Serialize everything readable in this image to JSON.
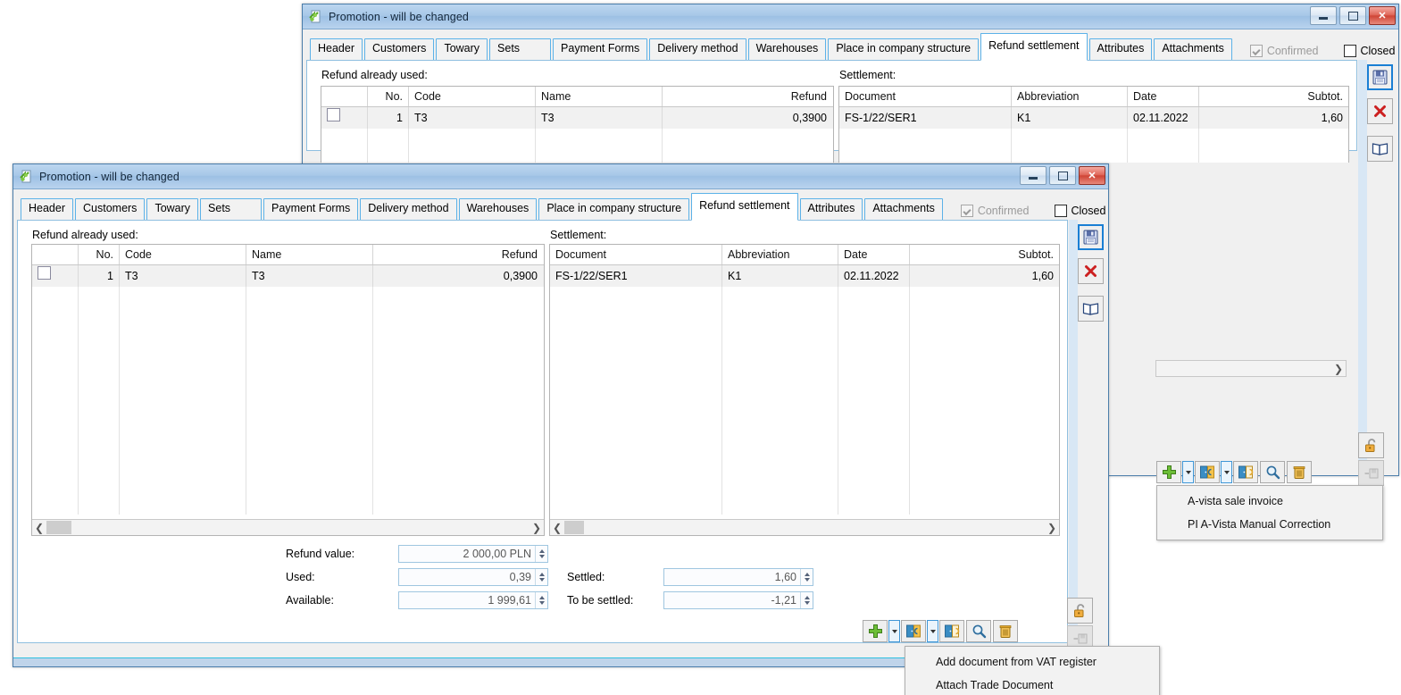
{
  "window1": {
    "title": "Promotion - will be changed",
    "app_icon": "promotion-icon",
    "controls": {
      "minimize": "minimize",
      "maximize": "maximize",
      "close": "close"
    },
    "tabs": [
      {
        "label": "Header",
        "active": false
      },
      {
        "label": "Customers",
        "active": false
      },
      {
        "label": "Towary",
        "active": false
      },
      {
        "label": "Sets",
        "active": false
      },
      {
        "label": "Payment Forms",
        "active": false
      },
      {
        "label": "Delivery method",
        "active": false
      },
      {
        "label": "Warehouses",
        "active": false
      },
      {
        "label": "Place in company structure",
        "active": false
      },
      {
        "label": "Refund settlement",
        "active": true
      },
      {
        "label": "Attributes",
        "active": false
      },
      {
        "label": "Attachments",
        "active": false
      }
    ],
    "confirmed": {
      "label": "Confirmed",
      "checked": true,
      "disabled": true
    },
    "closed": {
      "label": "Closed",
      "checked": false,
      "disabled": false
    },
    "refund_used": {
      "caption": "Refund already used:",
      "columns": [
        "",
        "No.",
        "Code",
        "Name",
        "Refund"
      ],
      "rows": [
        {
          "check": false,
          "no": "1",
          "code": "T3",
          "name": "T3",
          "refund": "0,3900"
        }
      ]
    },
    "settlement": {
      "caption": "Settlement:",
      "columns": [
        "Document",
        "Abbreviation",
        "Date",
        "Subtot."
      ],
      "rows": [
        {
          "document": "FS-1/22/SER1",
          "abbreviation": "K1",
          "date": "02.11.2022",
          "subtotal": "1,60"
        }
      ]
    },
    "side_toolbar": [
      {
        "name": "save-button",
        "icon": "floppy-disk-icon",
        "accent": true
      },
      {
        "name": "cancel-button",
        "icon": "red-x-icon",
        "accent": false
      },
      {
        "name": "book-button",
        "icon": "open-book-icon",
        "accent": false
      }
    ],
    "lock_buttons": [
      {
        "name": "unlock-button",
        "icon": "open-padlock-icon",
        "disabled": false
      },
      {
        "name": "pin-save-button",
        "icon": "pin-save-icon",
        "disabled": true
      }
    ],
    "bottom_toolbar": [
      {
        "name": "add-button",
        "icon": "green-plus-icon"
      },
      {
        "name": "add-dropdown-arrow",
        "icon": "caret-down-icon"
      },
      {
        "name": "attach-document-button",
        "icon": "door-in-icon"
      },
      {
        "name": "attach-dropdown-arrow",
        "icon": "caret-down-icon"
      },
      {
        "name": "detach-document-button",
        "icon": "door-out-icon"
      },
      {
        "name": "preview-button",
        "icon": "magnifier-icon"
      },
      {
        "name": "delete-button",
        "icon": "trash-icon"
      }
    ],
    "context_menu": {
      "items": [
        "A-vista sale invoice",
        "PI A-Vista Manual Correction"
      ]
    }
  },
  "window2": {
    "title": "Promotion - will be changed",
    "app_icon": "promotion-icon",
    "controls": {
      "minimize": "minimize",
      "maximize": "maximize",
      "close": "close"
    },
    "tabs": [
      {
        "label": "Header",
        "active": false
      },
      {
        "label": "Customers",
        "active": false
      },
      {
        "label": "Towary",
        "active": false
      },
      {
        "label": "Sets",
        "active": false
      },
      {
        "label": "Payment Forms",
        "active": false
      },
      {
        "label": "Delivery method",
        "active": false
      },
      {
        "label": "Warehouses",
        "active": false
      },
      {
        "label": "Place in company structure",
        "active": false
      },
      {
        "label": "Refund settlement",
        "active": true
      },
      {
        "label": "Attributes",
        "active": false
      },
      {
        "label": "Attachments",
        "active": false
      }
    ],
    "confirmed": {
      "label": "Confirmed",
      "checked": true,
      "disabled": true
    },
    "closed": {
      "label": "Closed",
      "checked": false,
      "disabled": false
    },
    "refund_used": {
      "caption": "Refund already used:",
      "columns": [
        "",
        "No.",
        "Code",
        "Name",
        "Refund"
      ],
      "rows": [
        {
          "check": false,
          "no": "1",
          "code": "T3",
          "name": "T3",
          "refund": "0,3900"
        }
      ]
    },
    "settlement": {
      "caption": "Settlement:",
      "columns": [
        "Document",
        "Abbreviation",
        "Date",
        "Subtot."
      ],
      "rows": [
        {
          "document": "FS-1/22/SER1",
          "abbreviation": "K1",
          "date": "02.11.2022",
          "subtotal": "1,60"
        }
      ]
    },
    "fields": {
      "refund_value": {
        "label": "Refund value:",
        "value": "2 000,00 PLN"
      },
      "used": {
        "label": "Used:",
        "value": "0,39"
      },
      "available": {
        "label": "Available:",
        "value": "1 999,61"
      },
      "settled": {
        "label": "Settled:",
        "value": "1,60"
      },
      "to_be_settled": {
        "label": "To be settled:",
        "value": "-1,21"
      }
    },
    "side_toolbar": [
      {
        "name": "save-button",
        "icon": "floppy-disk-icon",
        "accent": true
      },
      {
        "name": "cancel-button",
        "icon": "red-x-icon",
        "accent": false
      },
      {
        "name": "book-button",
        "icon": "open-book-icon",
        "accent": false
      }
    ],
    "lock_buttons": [
      {
        "name": "unlock-button",
        "icon": "open-padlock-icon",
        "disabled": false
      },
      {
        "name": "pin-save-button",
        "icon": "pin-save-icon",
        "disabled": true
      }
    ],
    "bottom_toolbar": [
      {
        "name": "add-button",
        "icon": "green-plus-icon"
      },
      {
        "name": "add-dropdown-arrow",
        "icon": "caret-down-icon"
      },
      {
        "name": "attach-document-button",
        "icon": "door-in-icon"
      },
      {
        "name": "attach-dropdown-arrow",
        "icon": "caret-down-icon"
      },
      {
        "name": "detach-document-button",
        "icon": "door-out-icon"
      },
      {
        "name": "preview-button",
        "icon": "magnifier-icon"
      },
      {
        "name": "delete-button",
        "icon": "trash-icon"
      }
    ],
    "context_menu": {
      "items": [
        "Add document from VAT register",
        "Attach Trade Document"
      ]
    }
  },
  "colors": {
    "title_bar": "#a8c8e8",
    "tab_border": "#5cb2e8",
    "accent_blue": "#1a7fd4",
    "close_red": "#cf4536",
    "row_bg": "#f1f1f1",
    "green_plus": "#6cbe36",
    "orange_lock": "#e8a33d"
  }
}
